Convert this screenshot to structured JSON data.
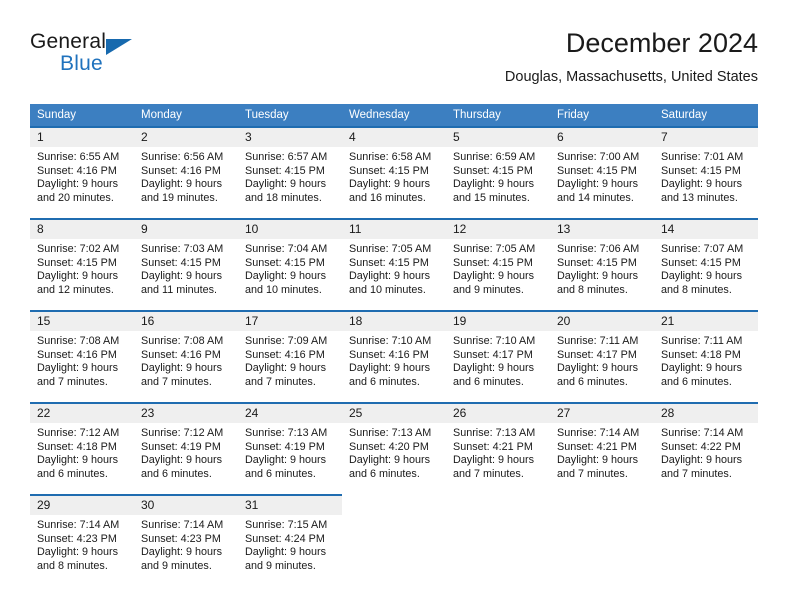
{
  "brand": {
    "name_part1": "General",
    "name_part2": "Blue",
    "logo_icon": "triangle-flag-icon"
  },
  "header": {
    "month_title": "December 2024",
    "location": "Douglas, Massachusetts, United States"
  },
  "colors": {
    "header_blue": "#3c7fc1",
    "row_rule_blue": "#1f6cb0",
    "daynum_band": "#efefef",
    "brand_blue": "#1f72bd"
  },
  "weekday_headers": [
    "Sunday",
    "Monday",
    "Tuesday",
    "Wednesday",
    "Thursday",
    "Friday",
    "Saturday"
  ],
  "weeks": [
    [
      {
        "day": "1",
        "sunrise": "Sunrise: 6:55 AM",
        "sunset": "Sunset: 4:16 PM",
        "daylight_l1": "Daylight: 9 hours",
        "daylight_l2": "and 20 minutes."
      },
      {
        "day": "2",
        "sunrise": "Sunrise: 6:56 AM",
        "sunset": "Sunset: 4:16 PM",
        "daylight_l1": "Daylight: 9 hours",
        "daylight_l2": "and 19 minutes."
      },
      {
        "day": "3",
        "sunrise": "Sunrise: 6:57 AM",
        "sunset": "Sunset: 4:15 PM",
        "daylight_l1": "Daylight: 9 hours",
        "daylight_l2": "and 18 minutes."
      },
      {
        "day": "4",
        "sunrise": "Sunrise: 6:58 AM",
        "sunset": "Sunset: 4:15 PM",
        "daylight_l1": "Daylight: 9 hours",
        "daylight_l2": "and 16 minutes."
      },
      {
        "day": "5",
        "sunrise": "Sunrise: 6:59 AM",
        "sunset": "Sunset: 4:15 PM",
        "daylight_l1": "Daylight: 9 hours",
        "daylight_l2": "and 15 minutes."
      },
      {
        "day": "6",
        "sunrise": "Sunrise: 7:00 AM",
        "sunset": "Sunset: 4:15 PM",
        "daylight_l1": "Daylight: 9 hours",
        "daylight_l2": "and 14 minutes."
      },
      {
        "day": "7",
        "sunrise": "Sunrise: 7:01 AM",
        "sunset": "Sunset: 4:15 PM",
        "daylight_l1": "Daylight: 9 hours",
        "daylight_l2": "and 13 minutes."
      }
    ],
    [
      {
        "day": "8",
        "sunrise": "Sunrise: 7:02 AM",
        "sunset": "Sunset: 4:15 PM",
        "daylight_l1": "Daylight: 9 hours",
        "daylight_l2": "and 12 minutes."
      },
      {
        "day": "9",
        "sunrise": "Sunrise: 7:03 AM",
        "sunset": "Sunset: 4:15 PM",
        "daylight_l1": "Daylight: 9 hours",
        "daylight_l2": "and 11 minutes."
      },
      {
        "day": "10",
        "sunrise": "Sunrise: 7:04 AM",
        "sunset": "Sunset: 4:15 PM",
        "daylight_l1": "Daylight: 9 hours",
        "daylight_l2": "and 10 minutes."
      },
      {
        "day": "11",
        "sunrise": "Sunrise: 7:05 AM",
        "sunset": "Sunset: 4:15 PM",
        "daylight_l1": "Daylight: 9 hours",
        "daylight_l2": "and 10 minutes."
      },
      {
        "day": "12",
        "sunrise": "Sunrise: 7:05 AM",
        "sunset": "Sunset: 4:15 PM",
        "daylight_l1": "Daylight: 9 hours",
        "daylight_l2": "and 9 minutes."
      },
      {
        "day": "13",
        "sunrise": "Sunrise: 7:06 AM",
        "sunset": "Sunset: 4:15 PM",
        "daylight_l1": "Daylight: 9 hours",
        "daylight_l2": "and 8 minutes."
      },
      {
        "day": "14",
        "sunrise": "Sunrise: 7:07 AM",
        "sunset": "Sunset: 4:15 PM",
        "daylight_l1": "Daylight: 9 hours",
        "daylight_l2": "and 8 minutes."
      }
    ],
    [
      {
        "day": "15",
        "sunrise": "Sunrise: 7:08 AM",
        "sunset": "Sunset: 4:16 PM",
        "daylight_l1": "Daylight: 9 hours",
        "daylight_l2": "and 7 minutes."
      },
      {
        "day": "16",
        "sunrise": "Sunrise: 7:08 AM",
        "sunset": "Sunset: 4:16 PM",
        "daylight_l1": "Daylight: 9 hours",
        "daylight_l2": "and 7 minutes."
      },
      {
        "day": "17",
        "sunrise": "Sunrise: 7:09 AM",
        "sunset": "Sunset: 4:16 PM",
        "daylight_l1": "Daylight: 9 hours",
        "daylight_l2": "and 7 minutes."
      },
      {
        "day": "18",
        "sunrise": "Sunrise: 7:10 AM",
        "sunset": "Sunset: 4:16 PM",
        "daylight_l1": "Daylight: 9 hours",
        "daylight_l2": "and 6 minutes."
      },
      {
        "day": "19",
        "sunrise": "Sunrise: 7:10 AM",
        "sunset": "Sunset: 4:17 PM",
        "daylight_l1": "Daylight: 9 hours",
        "daylight_l2": "and 6 minutes."
      },
      {
        "day": "20",
        "sunrise": "Sunrise: 7:11 AM",
        "sunset": "Sunset: 4:17 PM",
        "daylight_l1": "Daylight: 9 hours",
        "daylight_l2": "and 6 minutes."
      },
      {
        "day": "21",
        "sunrise": "Sunrise: 7:11 AM",
        "sunset": "Sunset: 4:18 PM",
        "daylight_l1": "Daylight: 9 hours",
        "daylight_l2": "and 6 minutes."
      }
    ],
    [
      {
        "day": "22",
        "sunrise": "Sunrise: 7:12 AM",
        "sunset": "Sunset: 4:18 PM",
        "daylight_l1": "Daylight: 9 hours",
        "daylight_l2": "and 6 minutes."
      },
      {
        "day": "23",
        "sunrise": "Sunrise: 7:12 AM",
        "sunset": "Sunset: 4:19 PM",
        "daylight_l1": "Daylight: 9 hours",
        "daylight_l2": "and 6 minutes."
      },
      {
        "day": "24",
        "sunrise": "Sunrise: 7:13 AM",
        "sunset": "Sunset: 4:19 PM",
        "daylight_l1": "Daylight: 9 hours",
        "daylight_l2": "and 6 minutes."
      },
      {
        "day": "25",
        "sunrise": "Sunrise: 7:13 AM",
        "sunset": "Sunset: 4:20 PM",
        "daylight_l1": "Daylight: 9 hours",
        "daylight_l2": "and 6 minutes."
      },
      {
        "day": "26",
        "sunrise": "Sunrise: 7:13 AM",
        "sunset": "Sunset: 4:21 PM",
        "daylight_l1": "Daylight: 9 hours",
        "daylight_l2": "and 7 minutes."
      },
      {
        "day": "27",
        "sunrise": "Sunrise: 7:14 AM",
        "sunset": "Sunset: 4:21 PM",
        "daylight_l1": "Daylight: 9 hours",
        "daylight_l2": "and 7 minutes."
      },
      {
        "day": "28",
        "sunrise": "Sunrise: 7:14 AM",
        "sunset": "Sunset: 4:22 PM",
        "daylight_l1": "Daylight: 9 hours",
        "daylight_l2": "and 7 minutes."
      }
    ],
    [
      {
        "day": "29",
        "sunrise": "Sunrise: 7:14 AM",
        "sunset": "Sunset: 4:23 PM",
        "daylight_l1": "Daylight: 9 hours",
        "daylight_l2": "and 8 minutes."
      },
      {
        "day": "30",
        "sunrise": "Sunrise: 7:14 AM",
        "sunset": "Sunset: 4:23 PM",
        "daylight_l1": "Daylight: 9 hours",
        "daylight_l2": "and 9 minutes."
      },
      {
        "day": "31",
        "sunrise": "Sunrise: 7:15 AM",
        "sunset": "Sunset: 4:24 PM",
        "daylight_l1": "Daylight: 9 hours",
        "daylight_l2": "and 9 minutes."
      },
      {
        "day": "",
        "sunrise": "",
        "sunset": "",
        "daylight_l1": "",
        "daylight_l2": ""
      },
      {
        "day": "",
        "sunrise": "",
        "sunset": "",
        "daylight_l1": "",
        "daylight_l2": ""
      },
      {
        "day": "",
        "sunrise": "",
        "sunset": "",
        "daylight_l1": "",
        "daylight_l2": ""
      },
      {
        "day": "",
        "sunrise": "",
        "sunset": "",
        "daylight_l1": "",
        "daylight_l2": ""
      }
    ]
  ]
}
